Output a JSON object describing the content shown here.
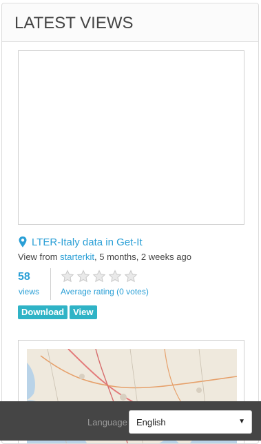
{
  "panel": {
    "title": "LATEST VIEWS"
  },
  "resource": {
    "title": "LTER-Italy data in Get-It",
    "view_from_prefix": "View from ",
    "owner": "starterkit",
    "time_ago": ", 5 months, 2 weeks ago",
    "views_count": "58",
    "views_label": "views",
    "rating_label": "Average rating (0 votes)",
    "rating_value": 0,
    "rating_max": 5,
    "download_label": "Download",
    "view_label": "View"
  },
  "footer": {
    "language_label": "Language",
    "language_value": "English"
  },
  "colors": {
    "accent": "#2a9fd6",
    "button": "#2fb3c6",
    "footer_bg": "#454545"
  },
  "icons": {
    "pin": "map-marker-icon",
    "star": "star-icon",
    "caret": "caret-down-icon"
  }
}
